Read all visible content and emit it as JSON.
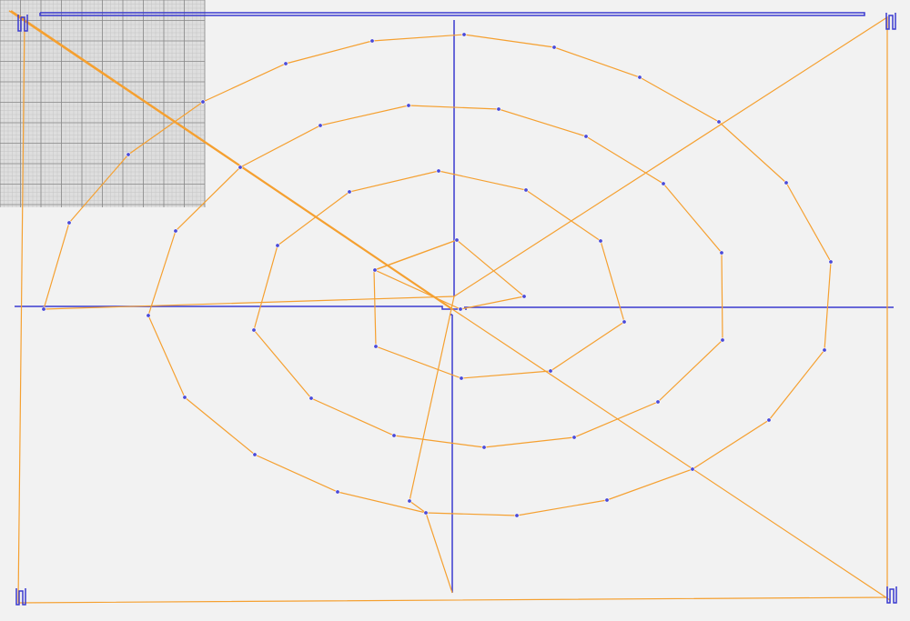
{
  "colors": {
    "background": "#f2f2f2",
    "path": "#f5a030",
    "axis": "#3a3ad0",
    "point_fill": "#4a4ad8",
    "point_stroke": "#ffffff",
    "grid_major": "#888888",
    "grid_minor": "#c4c4c4",
    "grid_background": "#dedede"
  },
  "icons": {
    "corner_markers": [
      "bracket-marker-icon",
      "bracket-marker-icon",
      "bracket-marker-icon",
      "bracket-marker-icon"
    ]
  },
  "toolpath": {
    "description_visible_text": "",
    "point_markers": true,
    "grid_panel_visible": true
  }
}
